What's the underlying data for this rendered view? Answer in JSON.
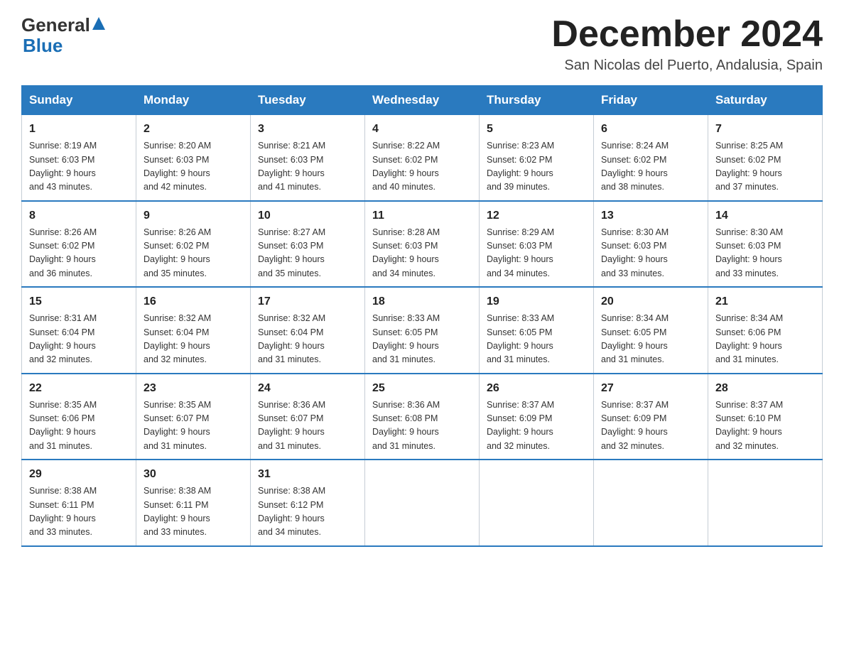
{
  "header": {
    "logo_general": "General",
    "logo_blue": "Blue",
    "month_title": "December 2024",
    "location": "San Nicolas del Puerto, Andalusia, Spain"
  },
  "days_of_week": [
    "Sunday",
    "Monday",
    "Tuesday",
    "Wednesday",
    "Thursday",
    "Friday",
    "Saturday"
  ],
  "weeks": [
    [
      {
        "day": "1",
        "sunrise": "8:19 AM",
        "sunset": "6:03 PM",
        "daylight": "9 hours and 43 minutes."
      },
      {
        "day": "2",
        "sunrise": "8:20 AM",
        "sunset": "6:03 PM",
        "daylight": "9 hours and 42 minutes."
      },
      {
        "day": "3",
        "sunrise": "8:21 AM",
        "sunset": "6:03 PM",
        "daylight": "9 hours and 41 minutes."
      },
      {
        "day": "4",
        "sunrise": "8:22 AM",
        "sunset": "6:02 PM",
        "daylight": "9 hours and 40 minutes."
      },
      {
        "day": "5",
        "sunrise": "8:23 AM",
        "sunset": "6:02 PM",
        "daylight": "9 hours and 39 minutes."
      },
      {
        "day": "6",
        "sunrise": "8:24 AM",
        "sunset": "6:02 PM",
        "daylight": "9 hours and 38 minutes."
      },
      {
        "day": "7",
        "sunrise": "8:25 AM",
        "sunset": "6:02 PM",
        "daylight": "9 hours and 37 minutes."
      }
    ],
    [
      {
        "day": "8",
        "sunrise": "8:26 AM",
        "sunset": "6:02 PM",
        "daylight": "9 hours and 36 minutes."
      },
      {
        "day": "9",
        "sunrise": "8:26 AM",
        "sunset": "6:02 PM",
        "daylight": "9 hours and 35 minutes."
      },
      {
        "day": "10",
        "sunrise": "8:27 AM",
        "sunset": "6:03 PM",
        "daylight": "9 hours and 35 minutes."
      },
      {
        "day": "11",
        "sunrise": "8:28 AM",
        "sunset": "6:03 PM",
        "daylight": "9 hours and 34 minutes."
      },
      {
        "day": "12",
        "sunrise": "8:29 AM",
        "sunset": "6:03 PM",
        "daylight": "9 hours and 34 minutes."
      },
      {
        "day": "13",
        "sunrise": "8:30 AM",
        "sunset": "6:03 PM",
        "daylight": "9 hours and 33 minutes."
      },
      {
        "day": "14",
        "sunrise": "8:30 AM",
        "sunset": "6:03 PM",
        "daylight": "9 hours and 33 minutes."
      }
    ],
    [
      {
        "day": "15",
        "sunrise": "8:31 AM",
        "sunset": "6:04 PM",
        "daylight": "9 hours and 32 minutes."
      },
      {
        "day": "16",
        "sunrise": "8:32 AM",
        "sunset": "6:04 PM",
        "daylight": "9 hours and 32 minutes."
      },
      {
        "day": "17",
        "sunrise": "8:32 AM",
        "sunset": "6:04 PM",
        "daylight": "9 hours and 31 minutes."
      },
      {
        "day": "18",
        "sunrise": "8:33 AM",
        "sunset": "6:05 PM",
        "daylight": "9 hours and 31 minutes."
      },
      {
        "day": "19",
        "sunrise": "8:33 AM",
        "sunset": "6:05 PM",
        "daylight": "9 hours and 31 minutes."
      },
      {
        "day": "20",
        "sunrise": "8:34 AM",
        "sunset": "6:05 PM",
        "daylight": "9 hours and 31 minutes."
      },
      {
        "day": "21",
        "sunrise": "8:34 AM",
        "sunset": "6:06 PM",
        "daylight": "9 hours and 31 minutes."
      }
    ],
    [
      {
        "day": "22",
        "sunrise": "8:35 AM",
        "sunset": "6:06 PM",
        "daylight": "9 hours and 31 minutes."
      },
      {
        "day": "23",
        "sunrise": "8:35 AM",
        "sunset": "6:07 PM",
        "daylight": "9 hours and 31 minutes."
      },
      {
        "day": "24",
        "sunrise": "8:36 AM",
        "sunset": "6:07 PM",
        "daylight": "9 hours and 31 minutes."
      },
      {
        "day": "25",
        "sunrise": "8:36 AM",
        "sunset": "6:08 PM",
        "daylight": "9 hours and 31 minutes."
      },
      {
        "day": "26",
        "sunrise": "8:37 AM",
        "sunset": "6:09 PM",
        "daylight": "9 hours and 32 minutes."
      },
      {
        "day": "27",
        "sunrise": "8:37 AM",
        "sunset": "6:09 PM",
        "daylight": "9 hours and 32 minutes."
      },
      {
        "day": "28",
        "sunrise": "8:37 AM",
        "sunset": "6:10 PM",
        "daylight": "9 hours and 32 minutes."
      }
    ],
    [
      {
        "day": "29",
        "sunrise": "8:38 AM",
        "sunset": "6:11 PM",
        "daylight": "9 hours and 33 minutes."
      },
      {
        "day": "30",
        "sunrise": "8:38 AM",
        "sunset": "6:11 PM",
        "daylight": "9 hours and 33 minutes."
      },
      {
        "day": "31",
        "sunrise": "8:38 AM",
        "sunset": "6:12 PM",
        "daylight": "9 hours and 34 minutes."
      },
      null,
      null,
      null,
      null
    ]
  ],
  "labels": {
    "sunrise": "Sunrise:",
    "sunset": "Sunset:",
    "daylight": "Daylight:"
  }
}
